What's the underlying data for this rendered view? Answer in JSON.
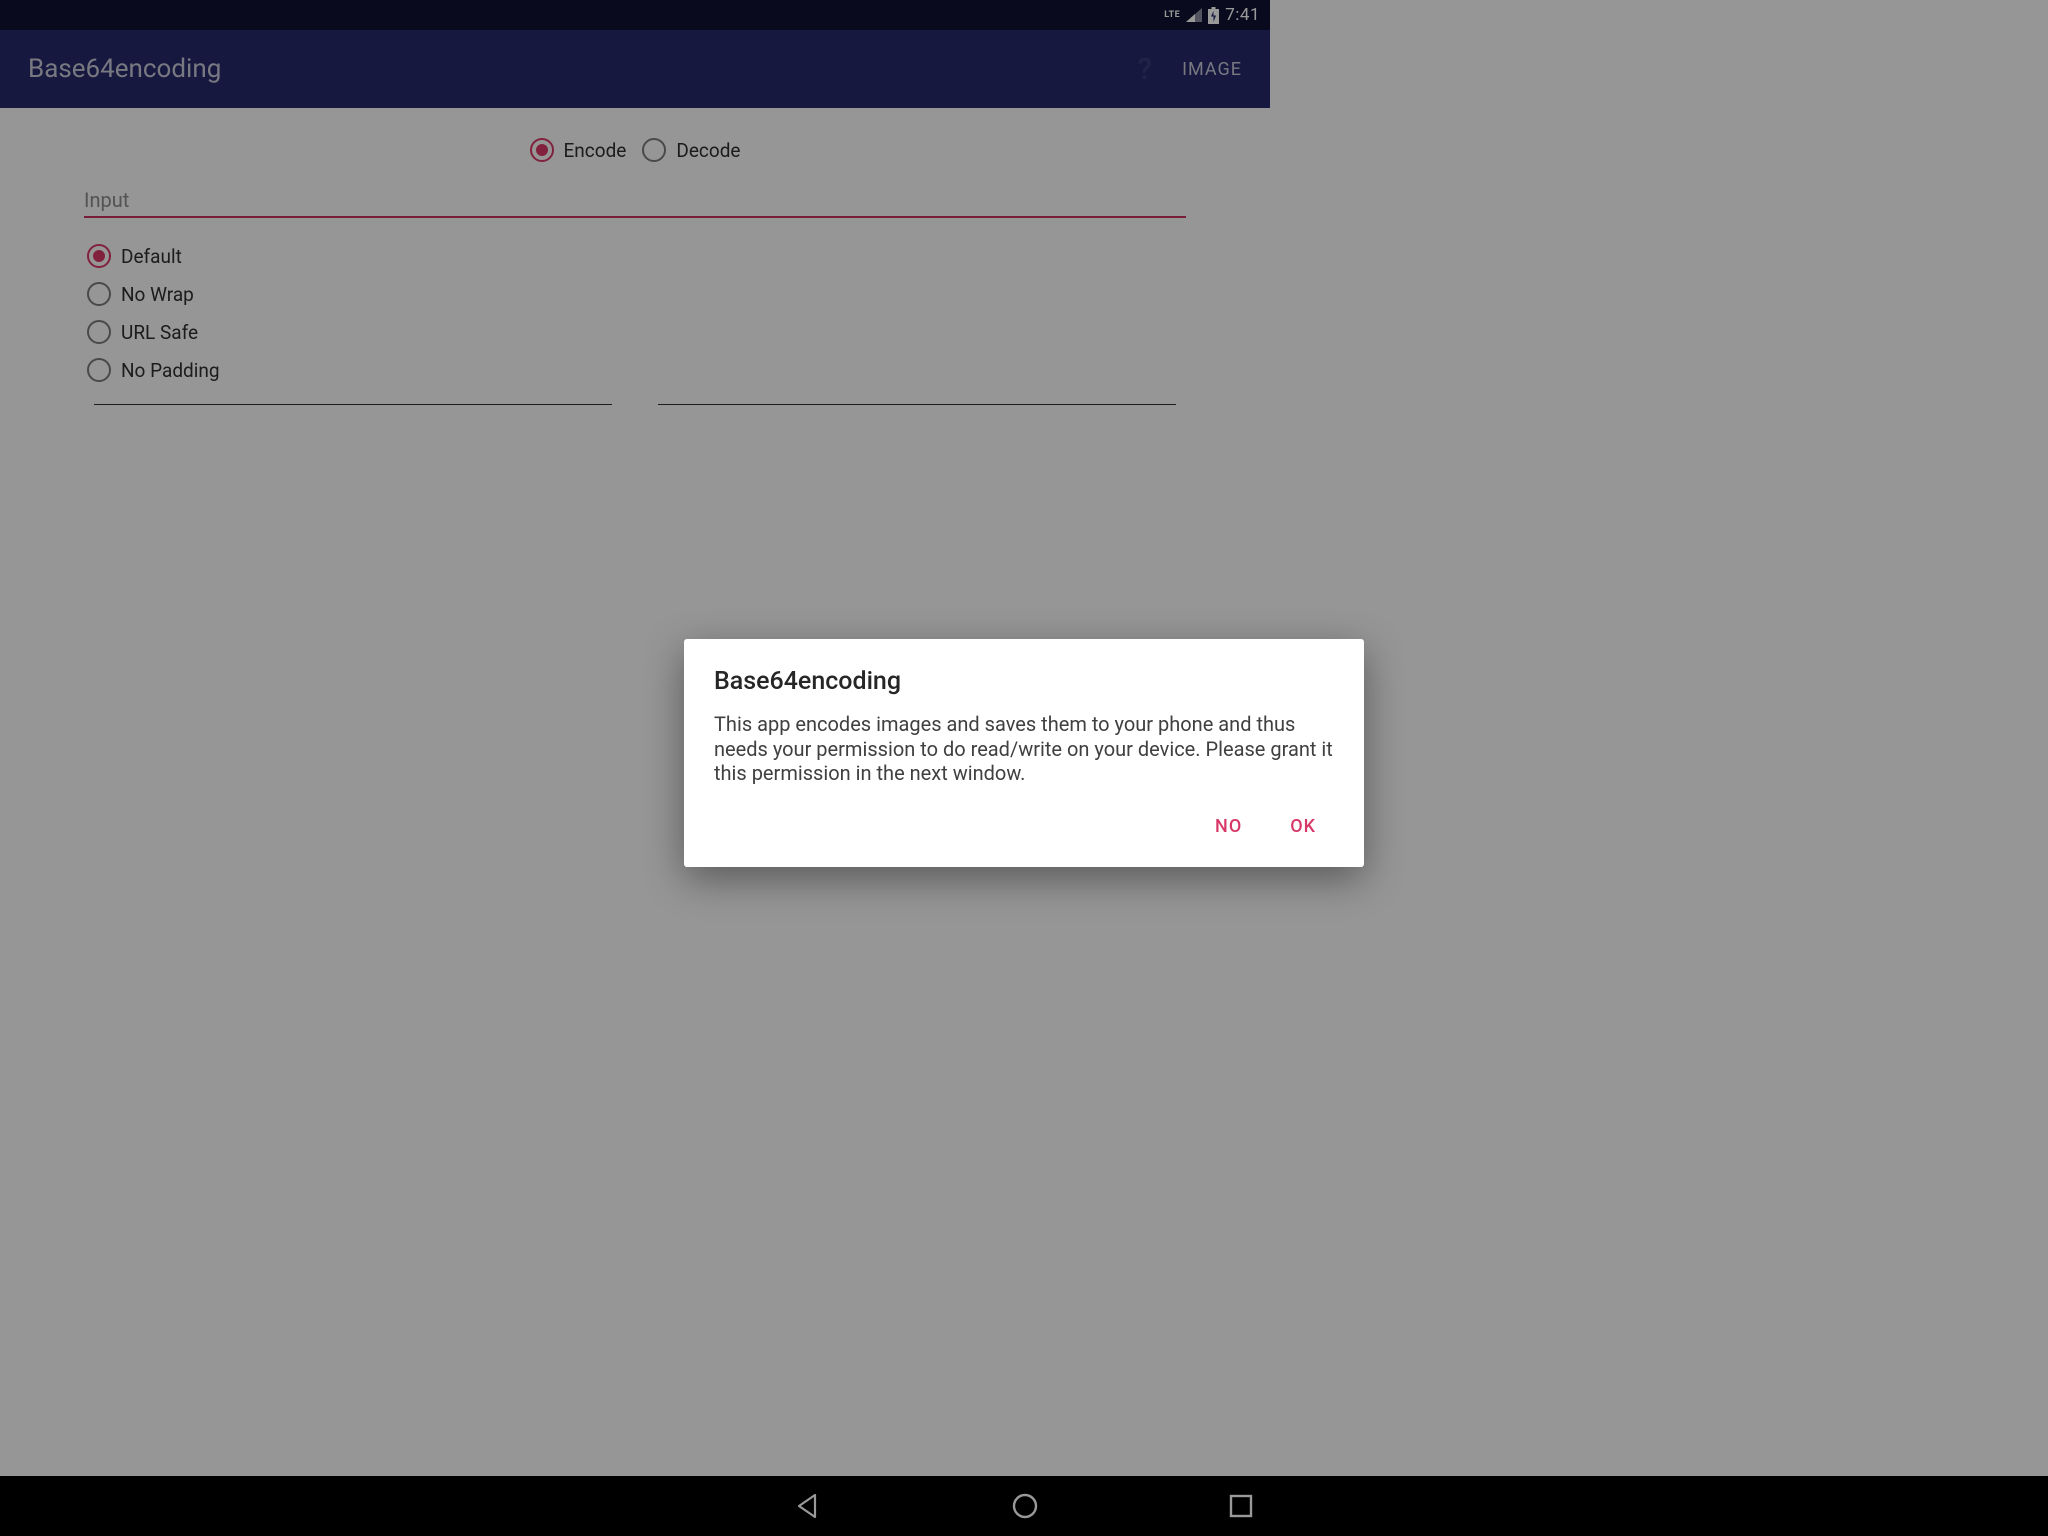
{
  "statusbar": {
    "network": "LTE",
    "time": "7:41"
  },
  "appbar": {
    "title": "Base64encoding",
    "action": "IMAGE"
  },
  "mode": {
    "encode": "Encode",
    "decode": "Decode",
    "selected": "encode"
  },
  "input": {
    "placeholder": "Input"
  },
  "options": {
    "items": [
      {
        "label": "Default",
        "selected": true
      },
      {
        "label": "No Wrap",
        "selected": false
      },
      {
        "label": "URL Safe",
        "selected": false
      },
      {
        "label": "No Padding",
        "selected": false
      }
    ]
  },
  "dialog": {
    "title": "Base64encoding",
    "body": "This app encodes images and saves them to your phone and thus needs your permission to do read/write on your device. Please grant it this permission in the next window.",
    "no": "NO",
    "ok": "OK"
  }
}
